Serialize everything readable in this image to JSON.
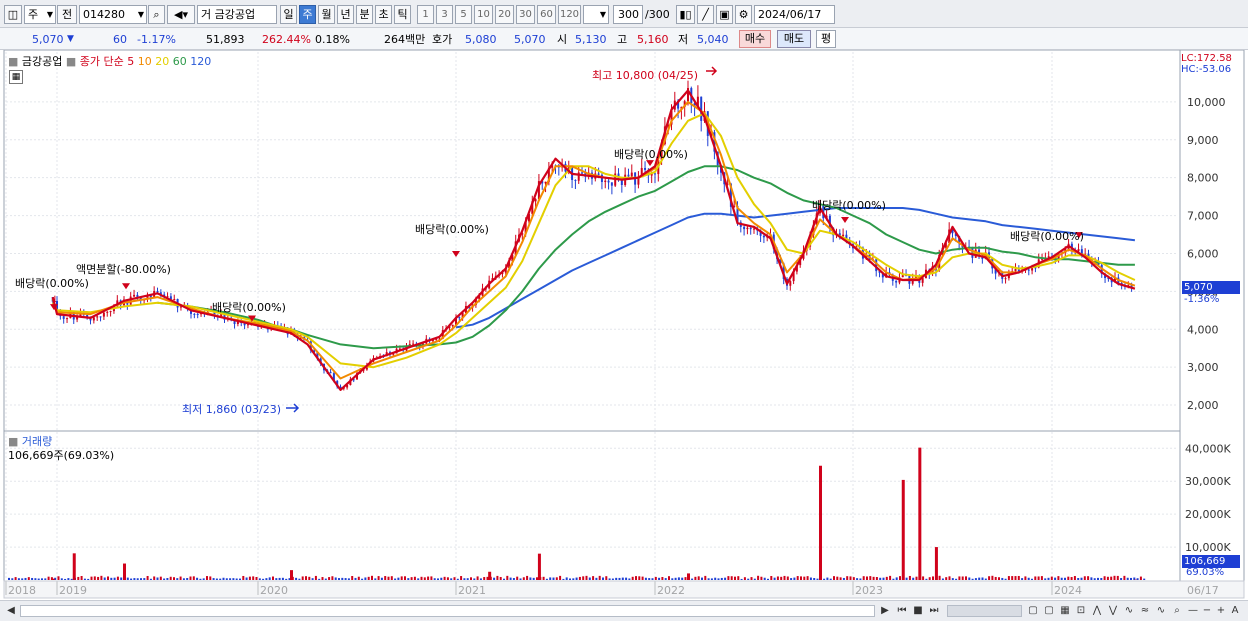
{
  "toolbar": {
    "period_select": "주",
    "prev_label": "전",
    "code": "014280",
    "speaker_prefix": "거",
    "stock_name": "금강공업",
    "period_buttons": [
      "일",
      "주",
      "월",
      "년",
      "분",
      "초",
      "틱"
    ],
    "active_period": "주",
    "interval_buttons": [
      "1",
      "3",
      "5",
      "10",
      "20",
      "30",
      "60",
      "120"
    ],
    "count": "300",
    "count_total": "/300",
    "date": "2024/06/17"
  },
  "quote": {
    "price": "5,070",
    "change": "60",
    "change_pct": "-1.17%",
    "volume": "51,893",
    "volume_ratio": "262.44%",
    "turnover": "0.18%",
    "amount": "264백만",
    "ask_label": "호가",
    "ask1": "5,080",
    "ask2": "5,070",
    "open_label": "시",
    "open": "5,130",
    "high_label": "고",
    "high": "5,160",
    "low_label": "저",
    "low": "5,040",
    "buy_button": "매수",
    "sell_button": "매도",
    "eval_button": "평"
  },
  "price_legend": {
    "stock": "금강공업",
    "ma_title": "종가 단순",
    "ma_periods": [
      "5",
      "10",
      "20",
      "60",
      "120"
    ],
    "ma_colors": [
      "#d0021b",
      "#f28a00",
      "#e3cf00",
      "#2e9a4a",
      "#2a5bd7"
    ]
  },
  "volume_legend": {
    "title": "거래량",
    "value": "106,669주(69.03%)"
  },
  "right_labels": {
    "lc": "LC:172.58",
    "hc": "HC:-53.06",
    "last_price": "5,070",
    "last_pct": "-1.36%",
    "last_volume": "106,669",
    "last_volume_pct": "69.03%"
  },
  "annotations": {
    "dividend_1": "배당락(0.00%)",
    "split": "액면분할(-80.00%)",
    "dividend_2": "배당락(0.00%)",
    "dividend_3": "배당락(0.00%)",
    "dividend_4": "배당락(0.00%)",
    "dividend_5": "배당락(0.00%)",
    "dividend_6": "배당락(0.00%)",
    "high": "최고 10,800 (04/25)",
    "low": "최저 1,860 (03/23)"
  },
  "chart_data": [
    {
      "type": "line",
      "title": "",
      "x_ticks": [
        "2018",
        "2019",
        "2020",
        "2021",
        "2022",
        "2023",
        "2024",
        "06/17"
      ],
      "y_ticks": [
        "2,000",
        "3,000",
        "4,000",
        "5,000",
        "6,000",
        "7,000",
        "8,000",
        "9,000",
        "10,000"
      ],
      "ylim": [
        1500,
        11000
      ],
      "x": [
        "2018-12",
        "2019-01",
        "2019-03",
        "2019-05",
        "2019-07",
        "2019-09",
        "2019-11",
        "2020-01",
        "2020-02",
        "2020-03",
        "2020-04",
        "2020-06",
        "2020-08",
        "2020-10",
        "2020-12",
        "2021-01",
        "2021-02",
        "2021-03",
        "2021-04",
        "2021-05",
        "2021-06",
        "2021-07",
        "2021-08",
        "2021-09",
        "2021-10",
        "2021-11",
        "2021-12",
        "2022-01",
        "2022-02",
        "2022-03",
        "2022-04",
        "2022-05",
        "2022-06",
        "2022-07",
        "2022-08",
        "2022-09",
        "2022-10",
        "2022-11",
        "2022-12",
        "2023-01",
        "2023-02",
        "2023-03",
        "2023-04",
        "2023-05",
        "2023-06",
        "2023-07",
        "2023-08",
        "2023-09",
        "2023-10",
        "2023-11",
        "2023-12",
        "2024-01",
        "2024-02",
        "2024-03",
        "2024-04",
        "2024-05",
        "2024-06"
      ],
      "series": [
        {
          "values": [
            4850,
            4400,
            4300,
            4750,
            4950,
            4500,
            4300,
            4100,
            4000,
            3900,
            3600,
            2400,
            3200,
            3500,
            3800,
            4300,
            4700,
            5200,
            5600,
            6600,
            7800,
            8500,
            8100,
            8050,
            8000,
            7950,
            8000,
            8300,
            9800,
            10300,
            9600,
            8300,
            6800,
            6700,
            6400,
            5200,
            6000,
            7200,
            6500,
            6200,
            5800,
            5400,
            5300,
            5300,
            5700,
            6700,
            6000,
            5900,
            5400,
            5500,
            5700,
            5900,
            6200,
            5900,
            5500,
            5200,
            5070
          ]
        },
        {
          "values": [
            4800,
            4450,
            4400,
            4700,
            4850,
            4550,
            4300,
            4150,
            4050,
            3950,
            3700,
            2700,
            3100,
            3400,
            3700,
            4100,
            4600,
            5000,
            5400,
            6300,
            7400,
            8300,
            8300,
            8100,
            8000,
            7950,
            8000,
            8250,
            9500,
            10000,
            9700,
            8600,
            7200,
            6800,
            6500,
            5500,
            6000,
            6900,
            6500,
            6200,
            5900,
            5500,
            5300,
            5350,
            5600,
            6400,
            6100,
            5950,
            5500,
            5500,
            5700,
            5850,
            6100,
            5950,
            5600,
            5300,
            5150
          ]
        },
        {
          "values": [
            4700,
            4500,
            4450,
            4600,
            4700,
            4600,
            4400,
            4200,
            4100,
            4000,
            3800,
            3100,
            3000,
            3250,
            3600,
            3900,
            4300,
            4700,
            5100,
            5800,
            6800,
            7800,
            8300,
            8300,
            8100,
            8000,
            8000,
            8150,
            8900,
            9500,
            9700,
            9100,
            8000,
            7300,
            6800,
            6100,
            6000,
            6600,
            6500,
            6300,
            6000,
            5700,
            5450,
            5400,
            5500,
            5900,
            6000,
            6000,
            5700,
            5600,
            5650,
            5750,
            5950,
            5950,
            5750,
            5500,
            5300
          ]
        },
        {
          "values": [
            null,
            null,
            null,
            null,
            4700,
            4600,
            4450,
            4250,
            4100,
            4000,
            3850,
            3600,
            3500,
            3550,
            3600,
            3650,
            3800,
            4100,
            4500,
            5000,
            5600,
            6100,
            6500,
            6850,
            7100,
            7300,
            7500,
            7650,
            7900,
            8150,
            8300,
            8300,
            8200,
            8000,
            7850,
            7600,
            7400,
            7300,
            7200,
            7000,
            6800,
            6500,
            6300,
            6100,
            6000,
            6100,
            6150,
            6150,
            6050,
            6000,
            5900,
            5850,
            5850,
            5800,
            5750,
            5700,
            5700
          ]
        },
        {
          "values": [
            null,
            null,
            null,
            null,
            null,
            null,
            null,
            null,
            null,
            null,
            null,
            null,
            null,
            null,
            null,
            4050,
            4120,
            4300,
            4550,
            4800,
            5050,
            5300,
            5550,
            5750,
            5950,
            6150,
            6350,
            6550,
            6750,
            6950,
            7050,
            7050,
            7000,
            6950,
            7000,
            7050,
            7100,
            7150,
            7200,
            7200,
            7200,
            7200,
            7200,
            7150,
            7050,
            6950,
            6900,
            6850,
            6750,
            6700,
            6650,
            6600,
            6550,
            6500,
            6450,
            6400,
            6350
          ]
        }
      ]
    },
    {
      "type": "bar",
      "title": "",
      "y_ticks": [
        "10,000K",
        "20,000K",
        "30,000K",
        "40,000K"
      ],
      "ylim": [
        0,
        41000
      ],
      "x": [
        "2018-12",
        "2019-02",
        "2019-05",
        "2020-03",
        "2021-03",
        "2021-06",
        "2022-03",
        "2022-11",
        "2023-04",
        "2023-05",
        "2023-06",
        "2024-06"
      ],
      "values": [
        400,
        8100,
        5000,
        3000,
        2500,
        8000,
        2000,
        34700,
        30400,
        40200,
        10000,
        107
      ],
      "baseline_level": 800
    }
  ]
}
